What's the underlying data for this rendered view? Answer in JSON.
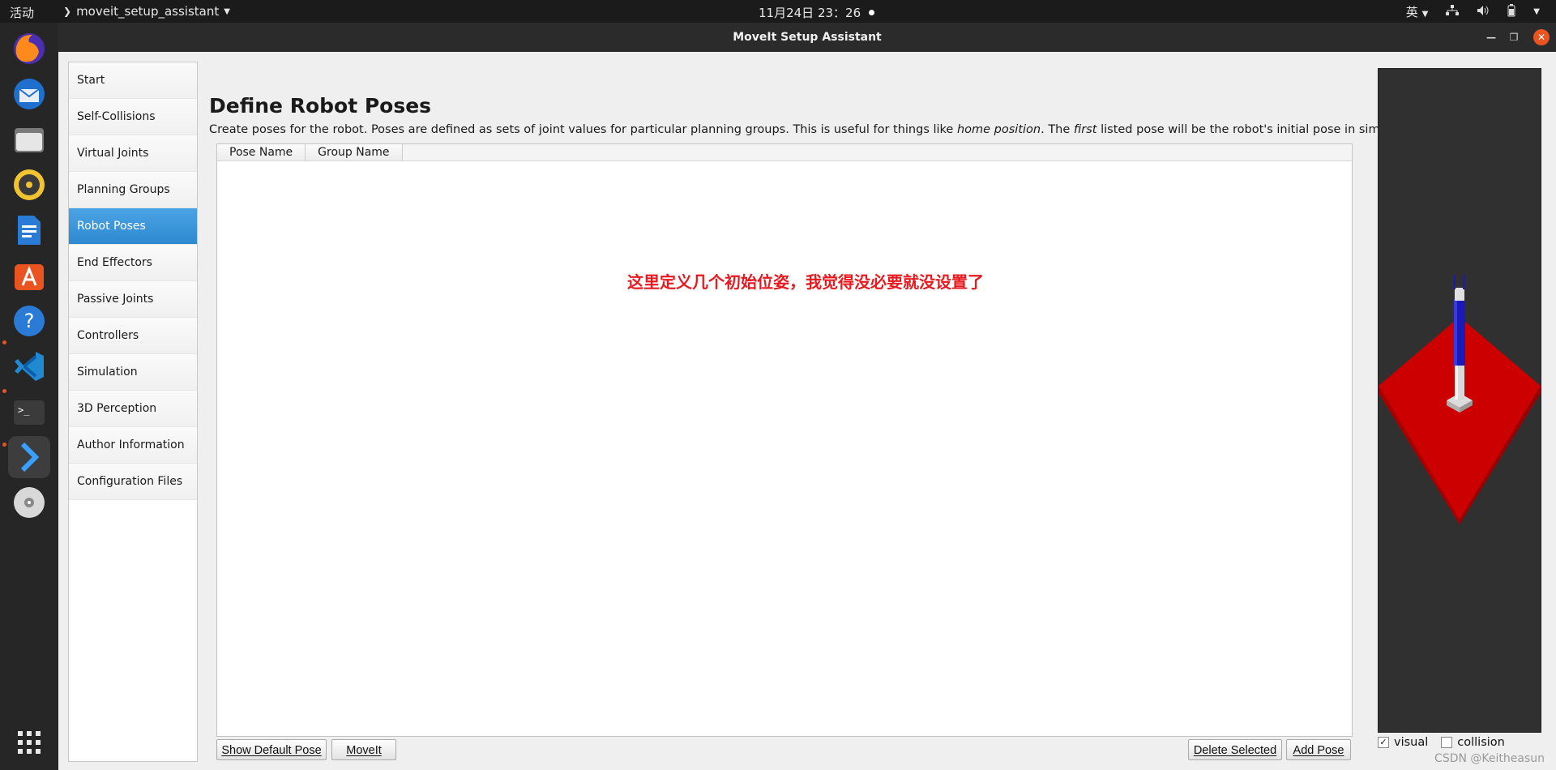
{
  "topbar": {
    "activities": "活动",
    "app_name": "moveit_setup_assistant",
    "clock": "11月24日  23：26",
    "input_method": "英"
  },
  "window": {
    "title": "MoveIt Setup Assistant"
  },
  "sidebar": {
    "items": [
      {
        "label": "Start"
      },
      {
        "label": "Self-Collisions"
      },
      {
        "label": "Virtual Joints"
      },
      {
        "label": "Planning Groups"
      },
      {
        "label": "Robot Poses"
      },
      {
        "label": "End Effectors"
      },
      {
        "label": "Passive Joints"
      },
      {
        "label": "Controllers"
      },
      {
        "label": "Simulation"
      },
      {
        "label": "3D Perception"
      },
      {
        "label": "Author Information"
      },
      {
        "label": "Configuration Files"
      }
    ],
    "selected": "Robot Poses"
  },
  "main": {
    "title": "Define Robot Poses",
    "description_parts": {
      "a": "Create poses for the robot. Poses are defined as sets of joint values for particular planning groups. This is useful for things like ",
      "b": "home position",
      "c": ". The ",
      "d": "first",
      "e": " listed pose will be the robot's initial pose in simulation."
    },
    "table": {
      "columns": [
        "Pose Name",
        "Group Name"
      ],
      "rows": []
    },
    "annotation": "这里定义几个初始位姿，我觉得没必要就没设置了",
    "buttons": {
      "show_default": "Show Default Pose",
      "moveit": "MoveIt",
      "delete_selected": "Delete Selected",
      "add_pose": "Add Pose"
    }
  },
  "viewer": {
    "visual_label": "visual",
    "visual_checked": true,
    "collision_label": "collision",
    "collision_checked": false
  },
  "watermark": "CSDN @Keitheasun"
}
